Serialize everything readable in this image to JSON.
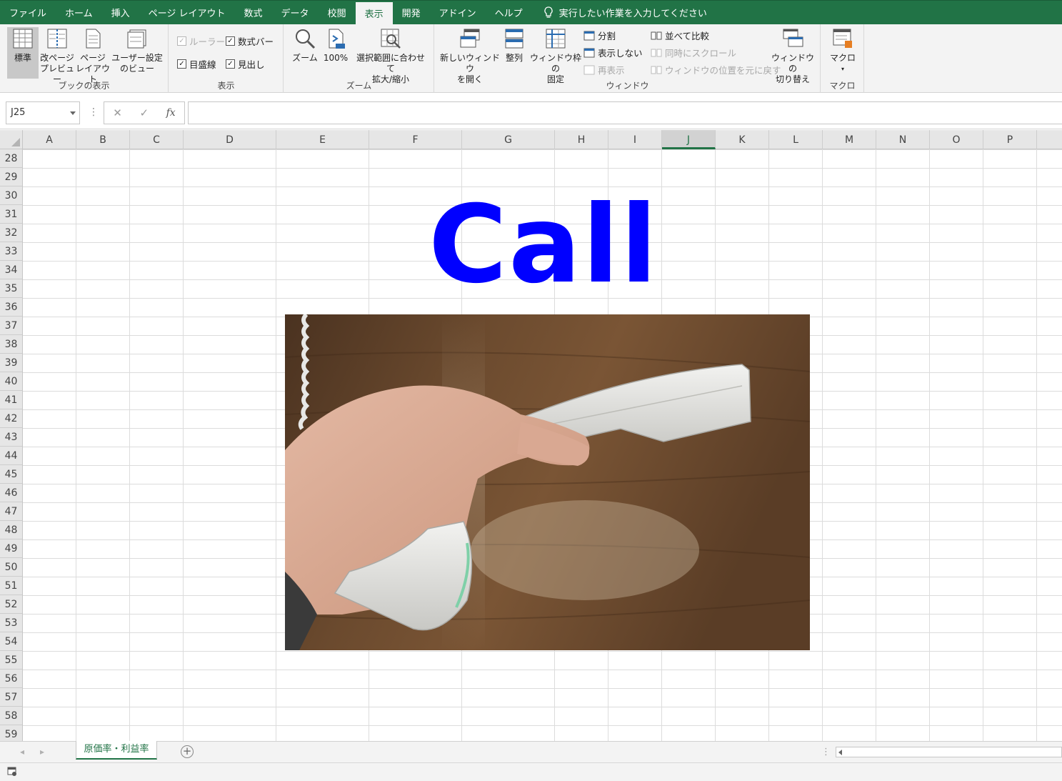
{
  "menu": {
    "tabs": [
      "ファイル",
      "ホーム",
      "挿入",
      "ページ レイアウト",
      "数式",
      "データ",
      "校閲",
      "表示",
      "開発",
      "アドイン",
      "ヘルプ"
    ],
    "active_tab": "表示",
    "tell_me": "実行したい作業を入力してください"
  },
  "ribbon": {
    "book_view": {
      "label": "ブックの表示",
      "normal": "標準",
      "page_break_1": "改ページ",
      "page_break_2": "プレビュー",
      "page_layout_1": "ページ",
      "page_layout_2": "レイアウト",
      "custom_1": "ユーザー設定",
      "custom_2": "のビュー"
    },
    "show": {
      "label": "表示",
      "ruler": "ルーラー",
      "formula_bar": "数式バー",
      "gridlines": "目盛線",
      "headings": "見出し"
    },
    "zoom": {
      "label": "ズーム",
      "zoom": "ズーム",
      "hundred": "100%",
      "fit_1": "選択範囲に合わせて",
      "fit_2": "拡大/縮小"
    },
    "window": {
      "label": "ウィンドウ",
      "new_window_1": "新しいウィンドウ",
      "new_window_2": "を開く",
      "arrange": "整列",
      "freeze_1": "ウィンドウ枠の",
      "freeze_2": "固定",
      "split": "分割",
      "hide": "表示しない",
      "unhide": "再表示",
      "side_by_side": "並べて比較",
      "sync_scroll": "同時にスクロール",
      "reset_pos": "ウィンドウの位置を元に戻す",
      "switch_1": "ウィンドウの",
      "switch_2": "切り替え"
    },
    "macro": {
      "label": "マクロ",
      "macro": "マクロ"
    }
  },
  "formula_bar": {
    "name_box": "J25",
    "fx": "fx",
    "value": ""
  },
  "grid": {
    "columns": [
      "A",
      "B",
      "C",
      "D",
      "E",
      "F",
      "G",
      "H",
      "I",
      "J",
      "K",
      "L",
      "M",
      "N",
      "O",
      "P"
    ],
    "active_column": "J",
    "rows": [
      "28",
      "29",
      "30",
      "31",
      "32",
      "33",
      "34",
      "35",
      "36",
      "37",
      "38",
      "39",
      "40",
      "41",
      "42",
      "43",
      "44",
      "45",
      "46",
      "47",
      "48",
      "49",
      "50",
      "51",
      "52",
      "53",
      "54",
      "55",
      "56",
      "57",
      "58",
      "59"
    ],
    "heading_text": "Call",
    "heading_color": "#0000ff"
  },
  "sheet": {
    "tab_name": "原価率・利益率"
  },
  "colors": {
    "accent": "#217346"
  }
}
